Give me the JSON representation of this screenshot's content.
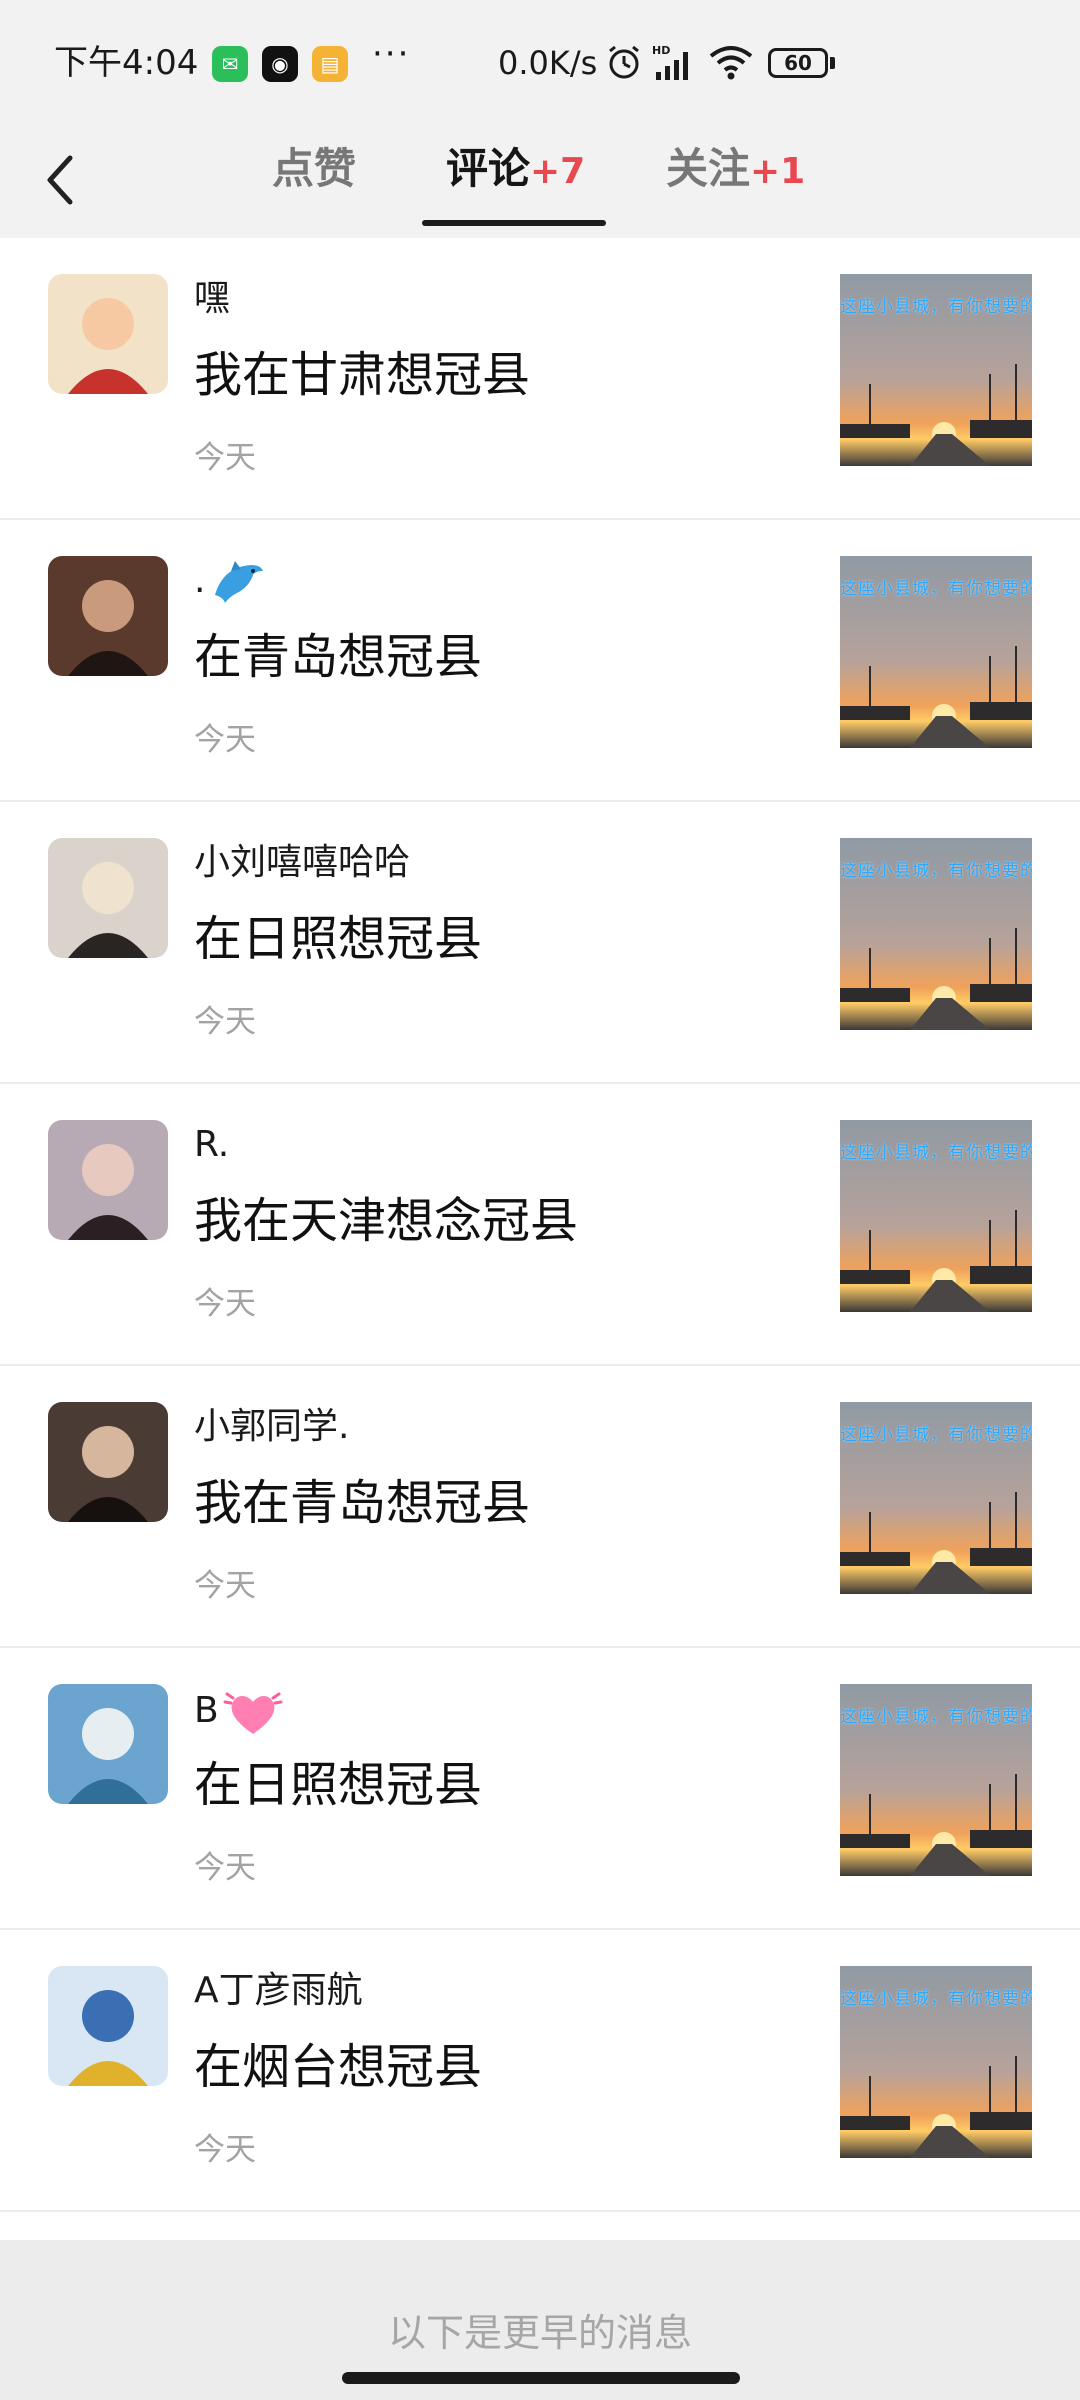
{
  "status_bar": {
    "time": "下午4:04",
    "app_icons": [
      "wechat-icon",
      "pq-app-icon",
      "note-app-icon"
    ],
    "more_indicator": "···",
    "net_speed": "0.0K/s",
    "icons": [
      "alarm-icon",
      "hd-signal-icon",
      "wifi-icon"
    ],
    "battery": "60"
  },
  "header": {
    "back_icon": "chevron-left-icon",
    "tabs": [
      {
        "label": "点赞",
        "badge": ""
      },
      {
        "label": "评论",
        "badge": "+7"
      },
      {
        "label": "关注",
        "badge": "+1"
      }
    ],
    "active_tab": 1
  },
  "notifications": [
    {
      "name": "嘿",
      "name_emoji": "",
      "comment": "我在甘肃想冠县",
      "time": "今天"
    },
    {
      "name": ".",
      "name_emoji": "dolphin-emoji",
      "comment": "在青岛想冠县",
      "time": "今天"
    },
    {
      "name": "小刘嘻嘻哈哈",
      "name_emoji": "",
      "comment": "在日照想冠县",
      "time": "今天"
    },
    {
      "name": "R.",
      "name_emoji": "",
      "comment": "我在天津想念冠县",
      "time": "今天"
    },
    {
      "name": "小郭同学.",
      "name_emoji": "",
      "comment": "我在青岛想冠县",
      "time": "今天"
    },
    {
      "name": "B",
      "name_emoji": "beating-heart-emoji",
      "comment": "在日照想冠县",
      "time": "今天"
    },
    {
      "name": "A丁彦雨航",
      "name_emoji": "",
      "comment": "在烟台想冠县",
      "time": "今天"
    }
  ],
  "thumbnail_caption": "这座小县城，有你想要的",
  "footer": {
    "earlier_label": "以下是更早的消息"
  },
  "colors": {
    "badge": "#e8484f",
    "background_top": "#f2f2f2",
    "time_text": "#a3a3a3"
  }
}
